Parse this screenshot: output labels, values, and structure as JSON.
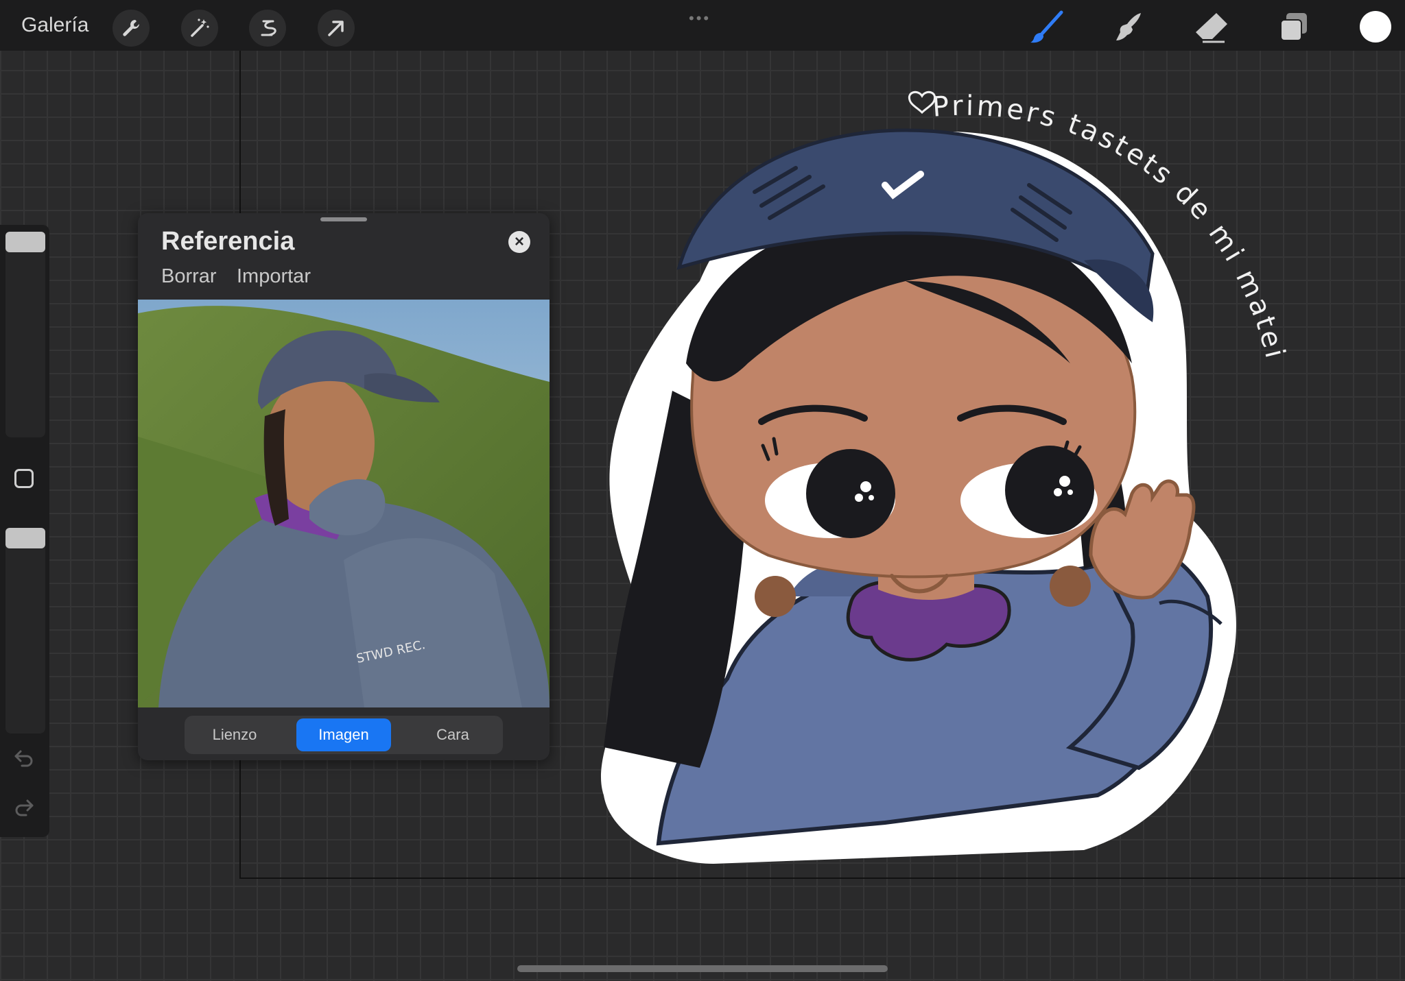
{
  "topbar": {
    "gallery_label": "Galería",
    "left_tools": [
      "wrench-icon",
      "magic-wand-icon",
      "selection-icon",
      "transform-arrow-icon"
    ],
    "right_tools": [
      "brush-icon",
      "smudge-icon",
      "eraser-icon",
      "layers-icon"
    ],
    "active_tool_color": "#2f7cf6",
    "current_color": "#ffffff"
  },
  "reference_panel": {
    "title": "Referencia",
    "actions": [
      "Borrar",
      "Importar"
    ],
    "tabs": [
      {
        "label": "Lienzo",
        "active": false
      },
      {
        "label": "Imagen",
        "active": true
      },
      {
        "label": "Cara",
        "active": false
      }
    ],
    "photo": {
      "hoodie_text": "STWD REC."
    }
  },
  "canvas": {
    "caption": "Primers tastets de mi mateixa"
  }
}
